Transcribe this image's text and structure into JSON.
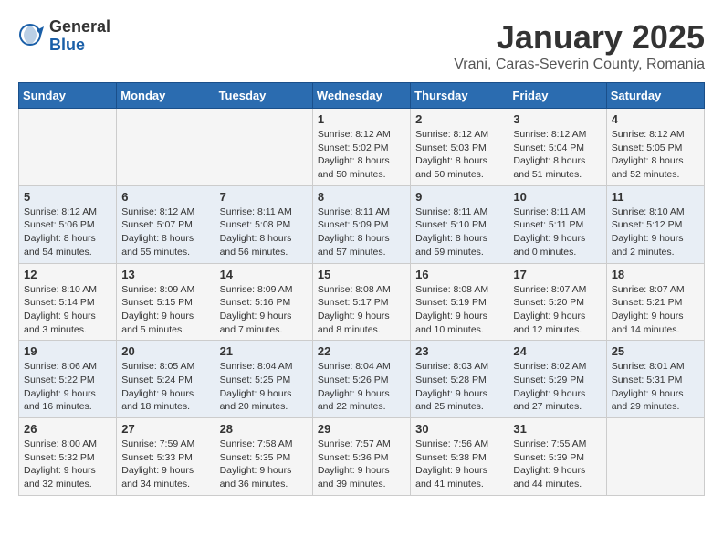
{
  "logo": {
    "general": "General",
    "blue": "Blue"
  },
  "title": "January 2025",
  "location": "Vrani, Caras-Severin County, Romania",
  "days_of_week": [
    "Sunday",
    "Monday",
    "Tuesday",
    "Wednesday",
    "Thursday",
    "Friday",
    "Saturday"
  ],
  "weeks": [
    [
      {
        "day": "",
        "info": ""
      },
      {
        "day": "",
        "info": ""
      },
      {
        "day": "",
        "info": ""
      },
      {
        "day": "1",
        "info": "Sunrise: 8:12 AM\nSunset: 5:02 PM\nDaylight: 8 hours and 50 minutes."
      },
      {
        "day": "2",
        "info": "Sunrise: 8:12 AM\nSunset: 5:03 PM\nDaylight: 8 hours and 50 minutes."
      },
      {
        "day": "3",
        "info": "Sunrise: 8:12 AM\nSunset: 5:04 PM\nDaylight: 8 hours and 51 minutes."
      },
      {
        "day": "4",
        "info": "Sunrise: 8:12 AM\nSunset: 5:05 PM\nDaylight: 8 hours and 52 minutes."
      }
    ],
    [
      {
        "day": "5",
        "info": "Sunrise: 8:12 AM\nSunset: 5:06 PM\nDaylight: 8 hours and 54 minutes."
      },
      {
        "day": "6",
        "info": "Sunrise: 8:12 AM\nSunset: 5:07 PM\nDaylight: 8 hours and 55 minutes."
      },
      {
        "day": "7",
        "info": "Sunrise: 8:11 AM\nSunset: 5:08 PM\nDaylight: 8 hours and 56 minutes."
      },
      {
        "day": "8",
        "info": "Sunrise: 8:11 AM\nSunset: 5:09 PM\nDaylight: 8 hours and 57 minutes."
      },
      {
        "day": "9",
        "info": "Sunrise: 8:11 AM\nSunset: 5:10 PM\nDaylight: 8 hours and 59 minutes."
      },
      {
        "day": "10",
        "info": "Sunrise: 8:11 AM\nSunset: 5:11 PM\nDaylight: 9 hours and 0 minutes."
      },
      {
        "day": "11",
        "info": "Sunrise: 8:10 AM\nSunset: 5:12 PM\nDaylight: 9 hours and 2 minutes."
      }
    ],
    [
      {
        "day": "12",
        "info": "Sunrise: 8:10 AM\nSunset: 5:14 PM\nDaylight: 9 hours and 3 minutes."
      },
      {
        "day": "13",
        "info": "Sunrise: 8:09 AM\nSunset: 5:15 PM\nDaylight: 9 hours and 5 minutes."
      },
      {
        "day": "14",
        "info": "Sunrise: 8:09 AM\nSunset: 5:16 PM\nDaylight: 9 hours and 7 minutes."
      },
      {
        "day": "15",
        "info": "Sunrise: 8:08 AM\nSunset: 5:17 PM\nDaylight: 9 hours and 8 minutes."
      },
      {
        "day": "16",
        "info": "Sunrise: 8:08 AM\nSunset: 5:19 PM\nDaylight: 9 hours and 10 minutes."
      },
      {
        "day": "17",
        "info": "Sunrise: 8:07 AM\nSunset: 5:20 PM\nDaylight: 9 hours and 12 minutes."
      },
      {
        "day": "18",
        "info": "Sunrise: 8:07 AM\nSunset: 5:21 PM\nDaylight: 9 hours and 14 minutes."
      }
    ],
    [
      {
        "day": "19",
        "info": "Sunrise: 8:06 AM\nSunset: 5:22 PM\nDaylight: 9 hours and 16 minutes."
      },
      {
        "day": "20",
        "info": "Sunrise: 8:05 AM\nSunset: 5:24 PM\nDaylight: 9 hours and 18 minutes."
      },
      {
        "day": "21",
        "info": "Sunrise: 8:04 AM\nSunset: 5:25 PM\nDaylight: 9 hours and 20 minutes."
      },
      {
        "day": "22",
        "info": "Sunrise: 8:04 AM\nSunset: 5:26 PM\nDaylight: 9 hours and 22 minutes."
      },
      {
        "day": "23",
        "info": "Sunrise: 8:03 AM\nSunset: 5:28 PM\nDaylight: 9 hours and 25 minutes."
      },
      {
        "day": "24",
        "info": "Sunrise: 8:02 AM\nSunset: 5:29 PM\nDaylight: 9 hours and 27 minutes."
      },
      {
        "day": "25",
        "info": "Sunrise: 8:01 AM\nSunset: 5:31 PM\nDaylight: 9 hours and 29 minutes."
      }
    ],
    [
      {
        "day": "26",
        "info": "Sunrise: 8:00 AM\nSunset: 5:32 PM\nDaylight: 9 hours and 32 minutes."
      },
      {
        "day": "27",
        "info": "Sunrise: 7:59 AM\nSunset: 5:33 PM\nDaylight: 9 hours and 34 minutes."
      },
      {
        "day": "28",
        "info": "Sunrise: 7:58 AM\nSunset: 5:35 PM\nDaylight: 9 hours and 36 minutes."
      },
      {
        "day": "29",
        "info": "Sunrise: 7:57 AM\nSunset: 5:36 PM\nDaylight: 9 hours and 39 minutes."
      },
      {
        "day": "30",
        "info": "Sunrise: 7:56 AM\nSunset: 5:38 PM\nDaylight: 9 hours and 41 minutes."
      },
      {
        "day": "31",
        "info": "Sunrise: 7:55 AM\nSunset: 5:39 PM\nDaylight: 9 hours and 44 minutes."
      },
      {
        "day": "",
        "info": ""
      }
    ]
  ]
}
